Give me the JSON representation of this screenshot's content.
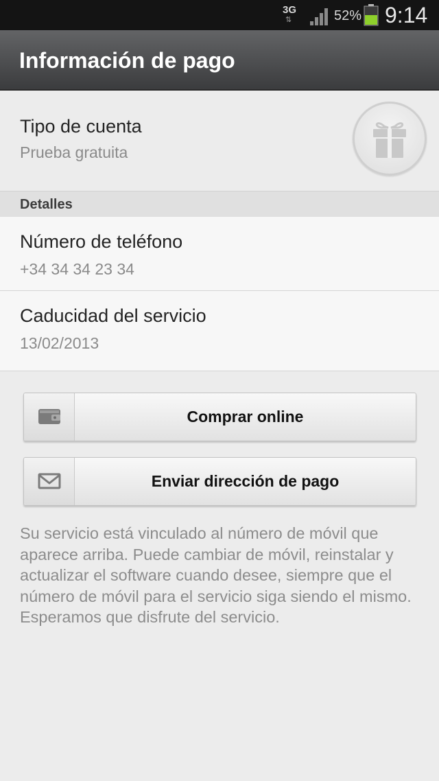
{
  "status_bar": {
    "network": "3G",
    "network_arrows": "⇅",
    "battery_percent": "52%",
    "battery_level": 0.52,
    "time": "9:14",
    "icons": [
      "signal-icon",
      "battery-icon"
    ]
  },
  "header": {
    "title": "Información de pago"
  },
  "account": {
    "title": "Tipo de cuenta",
    "value": "Prueba gratuita",
    "icon": "gift-icon"
  },
  "details": {
    "header": "Detalles",
    "phone": {
      "title": "Número de teléfono",
      "value": "+34  34  34 23 34"
    },
    "expiry": {
      "title": "Caducidad del servicio",
      "value": "13/02/2013"
    }
  },
  "buttons": {
    "buy_online": {
      "label": "Comprar online",
      "icon": "wallet-icon"
    },
    "send_payment_address": {
      "label": "Enviar dirección de pago",
      "icon": "envelope-icon"
    }
  },
  "info": {
    "text": "Su servicio está vinculado al número de móvil que aparece arriba. Puede cambiar de móvil, reinstalar y actualizar el software cuando desee, siempre que el número de móvil para el servicio siga siendo el mismo. Esperamos que disfrute del servicio."
  },
  "colors": {
    "status_bar": "#141414",
    "action_bar_top": "#636466",
    "action_bar_bottom": "#3b3c3e",
    "battery_fill": "#8ed02b"
  }
}
